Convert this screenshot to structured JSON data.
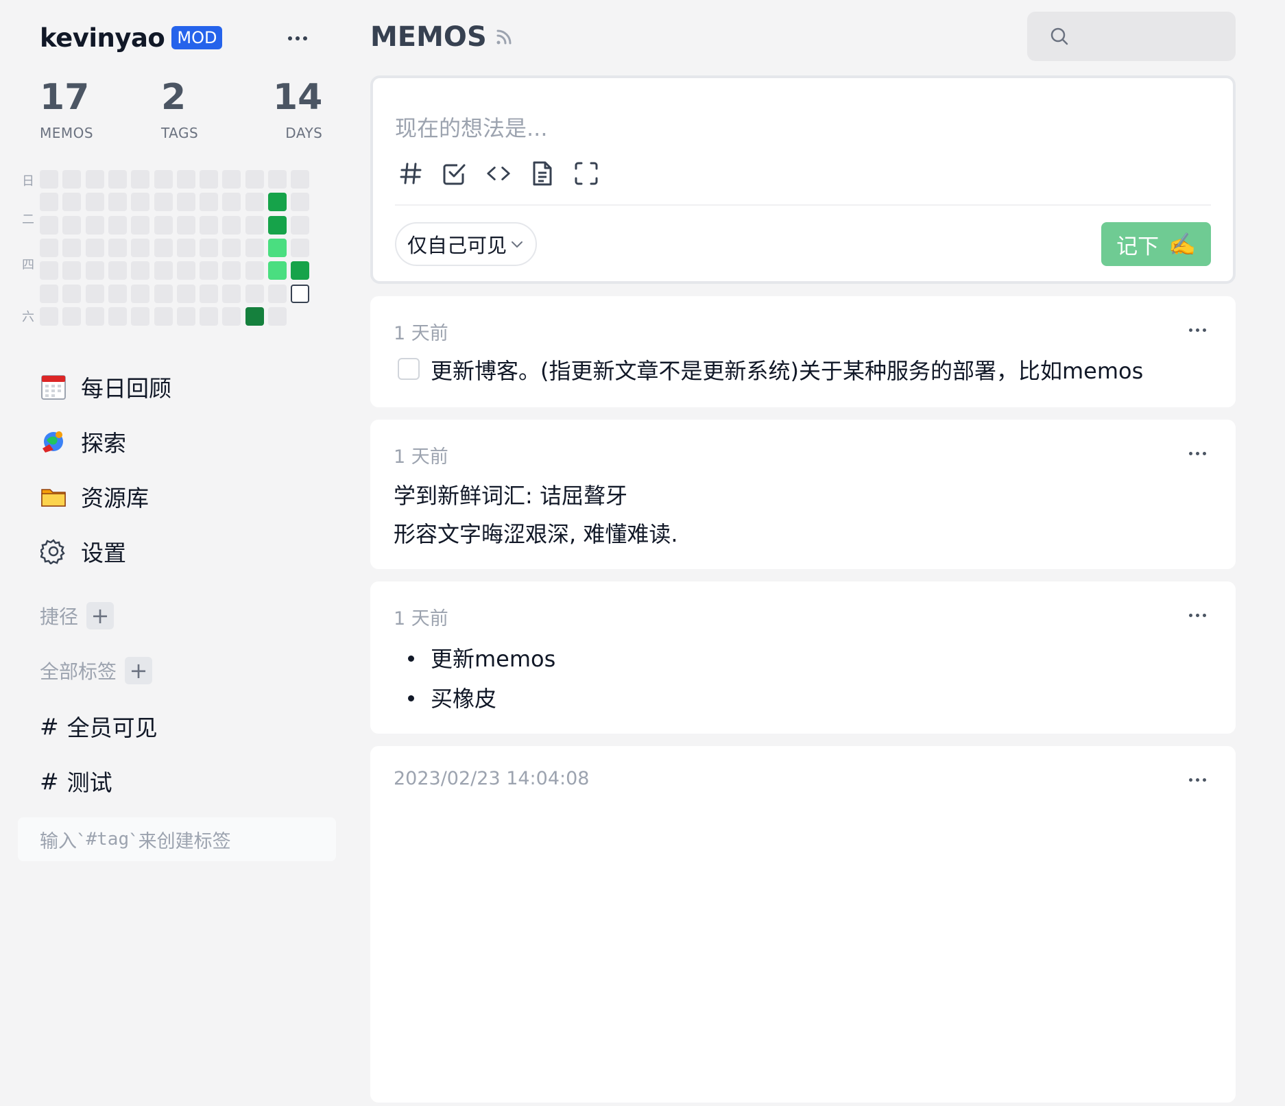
{
  "user": {
    "name": "kevinyao",
    "role_badge": "MOD"
  },
  "stats": [
    {
      "value": "17",
      "label": "MEMOS"
    },
    {
      "value": "2",
      "label": "TAGS"
    },
    {
      "value": "14",
      "label": "DAYS"
    }
  ],
  "heatmap": {
    "day_labels": [
      "日",
      "",
      "二",
      "",
      "四",
      "",
      "六"
    ],
    "colors": {
      "empty": "#e7e7ea",
      "low": "#4ade80",
      "mid": "#16a34a",
      "high": "#15803d"
    },
    "active_cells": [
      {
        "week": 10,
        "day": 1,
        "level": "mid"
      },
      {
        "week": 10,
        "day": 2,
        "level": "mid"
      },
      {
        "week": 10,
        "day": 3,
        "level": "low"
      },
      {
        "week": 10,
        "day": 4,
        "level": "low"
      },
      {
        "week": 11,
        "day": 4,
        "level": "mid"
      },
      {
        "week": 11,
        "day": 5,
        "level": "today"
      },
      {
        "week": 9,
        "day": 6,
        "level": "high"
      }
    ]
  },
  "nav": [
    {
      "label": "每日回顾",
      "icon": "calendar-icon"
    },
    {
      "label": "探索",
      "icon": "explore-icon"
    },
    {
      "label": "资源库",
      "icon": "folder-icon"
    },
    {
      "label": "设置",
      "icon": "gear-icon"
    }
  ],
  "shortcuts": {
    "title": "捷径"
  },
  "tags_section": {
    "title": "全部标签"
  },
  "tags": [
    "全员可见",
    "测试"
  ],
  "tag_hint": {
    "prefix": "输入`",
    "code": "#tag",
    "suffix": " `来创建标签"
  },
  "main": {
    "title": "MEMOS",
    "search_placeholder": ""
  },
  "editor": {
    "placeholder": "现在的想法是...",
    "tools": [
      "tag-icon",
      "checkbox-icon",
      "code-icon",
      "file-icon",
      "fullscreen-icon"
    ],
    "visibility": "仅自己可见",
    "save_label": "记下",
    "save_emoji": "✍️",
    "accent": "#6fcb93"
  },
  "memos": [
    {
      "time": "1 天前",
      "checkbox_text": "更新博客。(指更新文章不是更新系统)关于某种服务的部署，比如memos"
    },
    {
      "time": "1 天前",
      "lines": [
        "学到新鲜词汇: 诘屈聱牙",
        "形容文字晦涩艰深, 难懂难读."
      ]
    },
    {
      "time": "1 天前",
      "bullets": [
        "更新memos",
        "买橡皮"
      ]
    },
    {
      "time": "2023/02/23 14:04:08"
    }
  ]
}
